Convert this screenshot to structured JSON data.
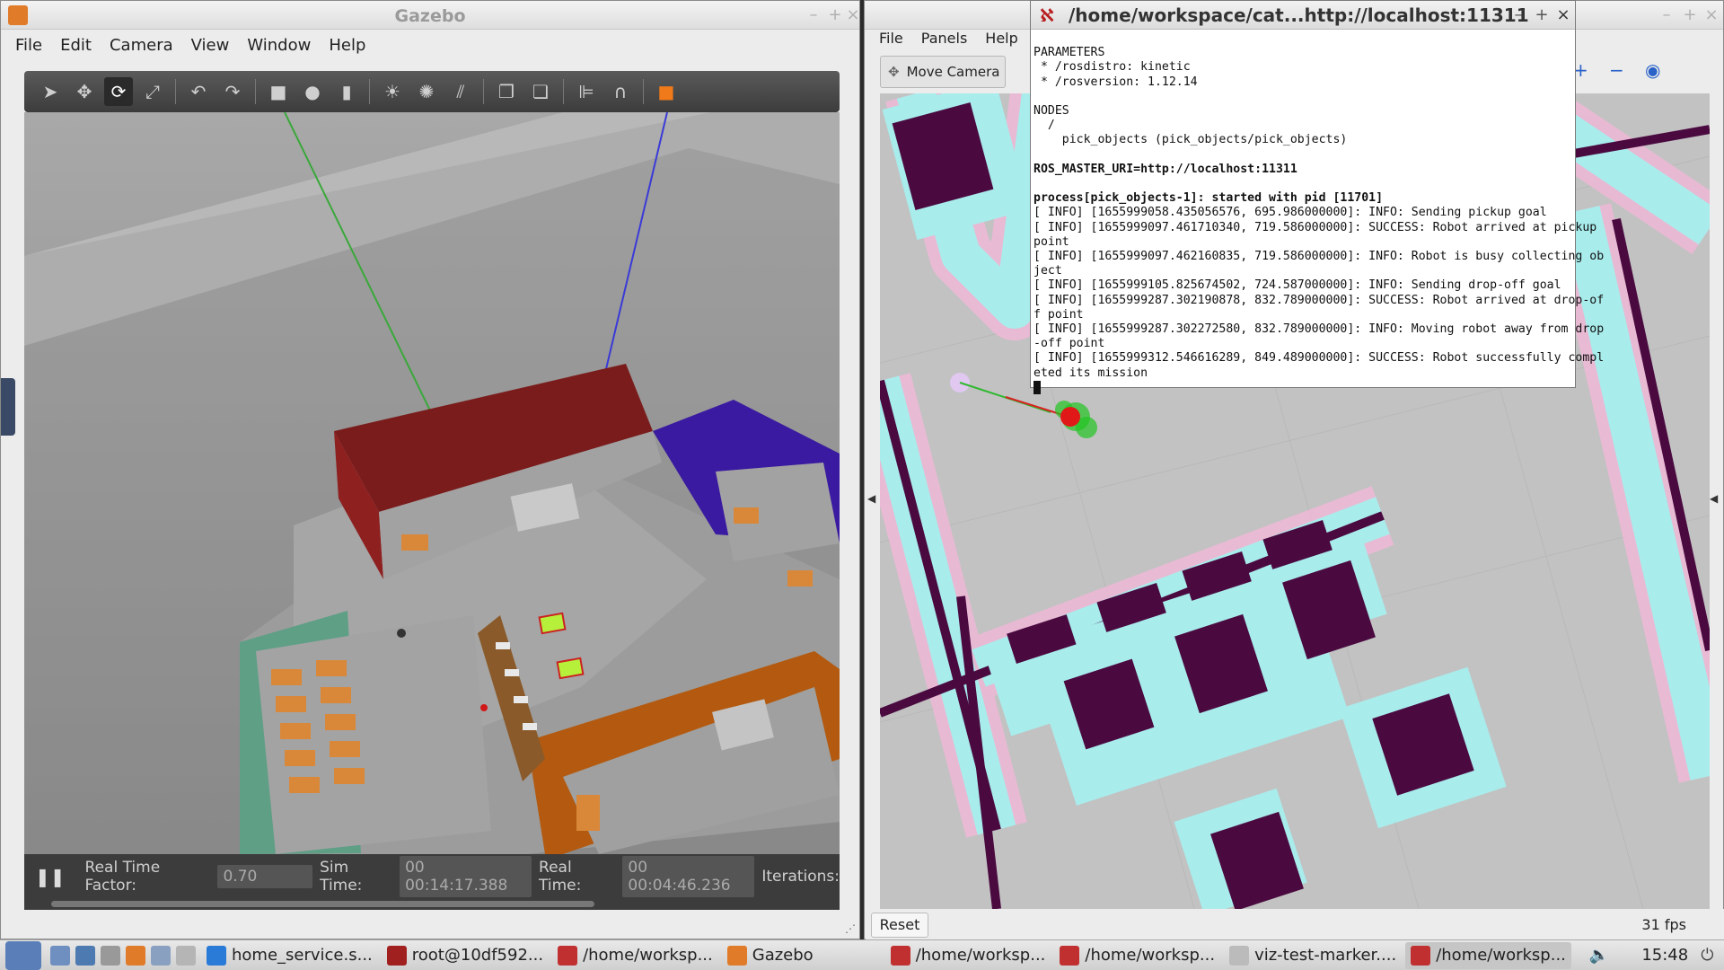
{
  "gazebo": {
    "title": "Gazebo",
    "menu": [
      "File",
      "Edit",
      "Camera",
      "View",
      "Window",
      "Help"
    ],
    "status": {
      "rtf_label": "Real Time Factor:",
      "rtf_value": "0.70",
      "sim_label": "Sim Time:",
      "sim_value": "00 00:14:17.388",
      "real_label": "Real Time:",
      "real_value": "00 00:04:46.236",
      "iter_label": "Iterations:"
    }
  },
  "rviz": {
    "menu": [
      "File",
      "Panels",
      "Help"
    ],
    "tool_label": "Move Camera",
    "reset_label": "Reset",
    "fps": "31 fps"
  },
  "terminal": {
    "title": "/home/workspace/cat...http://localhost:11311",
    "lines": [
      "PARAMETERS",
      " * /rosdistro: kinetic",
      " * /rosversion: 1.12.14",
      "",
      "NODES",
      "  /",
      "    pick_objects (pick_objects/pick_objects)",
      "",
      "ROS_MASTER_URI=http://localhost:11311",
      "",
      "process[pick_objects-1]: started with pid [11701]",
      "[ INFO] [1655999058.435056576, 695.986000000]: INFO: Sending pickup goal",
      "[ INFO] [1655999097.461710340, 719.586000000]: SUCCESS: Robot arrived at pickup",
      "point",
      "[ INFO] [1655999097.462160835, 719.586000000]: INFO: Robot is busy collecting ob",
      "ject",
      "[ INFO] [1655999105.825674502, 724.587000000]: INFO: Sending drop-off goal",
      "[ INFO] [1655999287.302190878, 832.789000000]: SUCCESS: Robot arrived at drop-of",
      "f point",
      "[ INFO] [1655999287.302272580, 832.789000000]: INFO: Moving robot away from drop",
      "-off point",
      "[ INFO] [1655999312.546616289, 849.489000000]: SUCCESS: Robot successfully compl",
      "eted its mission"
    ]
  },
  "taskbar": {
    "tasks": [
      "home_service.s...",
      "root@10df592...",
      "/home/worksp...",
      "Gazebo",
      "/home/worksp...",
      "/home/worksp...",
      "viz-test-marker....",
      "/home/worksp..."
    ],
    "clock": "15:48"
  }
}
